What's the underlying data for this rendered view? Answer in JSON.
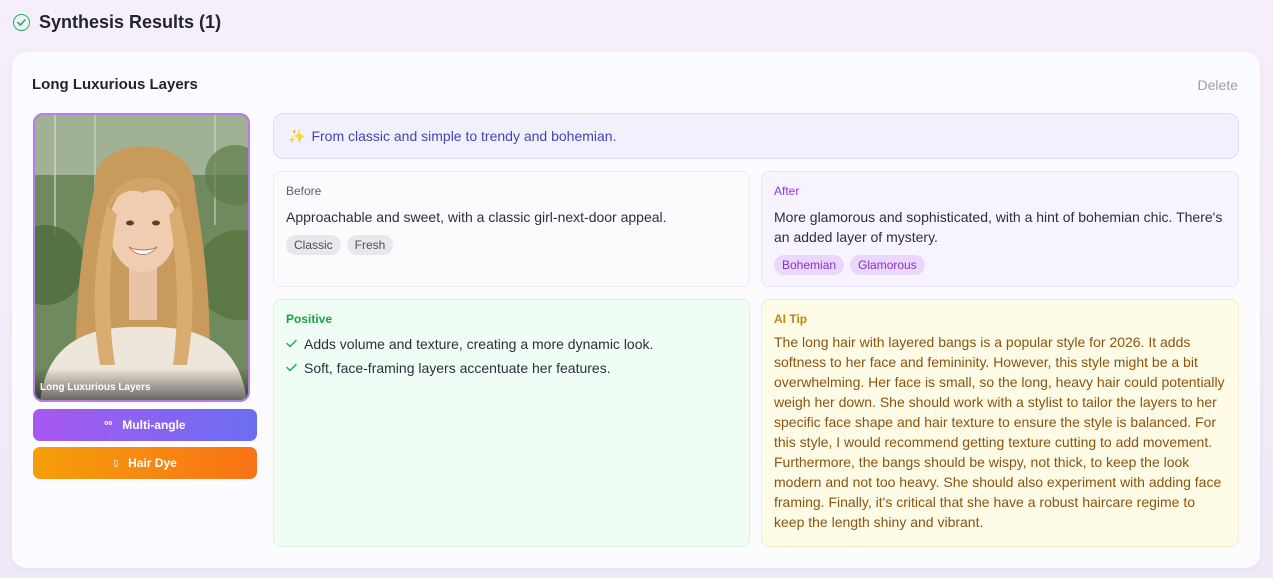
{
  "header": {
    "title": "Synthesis Results (1)"
  },
  "card": {
    "title": "Long Luxurious Layers",
    "delete_label": "Delete",
    "photo_caption": "Long Luxurious Layers",
    "buttons": {
      "multi_angle": {
        "icon": "⁰⁰",
        "label": "Multi-angle"
      },
      "hair_dye": {
        "icon": "▯",
        "label": "Hair Dye"
      }
    },
    "tagline": {
      "icon": "✨",
      "text": "From classic and simple to trendy and bohemian."
    },
    "before": {
      "label": "Before",
      "text": "Approachable and sweet, with a classic girl-next-door appeal.",
      "tags": [
        "Classic",
        "Fresh"
      ]
    },
    "after": {
      "label": "After",
      "text": "More glamorous and sophisticated, with a hint of bohemian chic. There's an added layer of mystery.",
      "tags": [
        "Bohemian",
        "Glamorous"
      ]
    },
    "positive": {
      "label": "Positive",
      "items": [
        "Adds volume and texture, creating a more dynamic look.",
        "Soft, face-framing layers accentuate her features."
      ]
    },
    "ai_tip": {
      "label": "AI Tip",
      "text": "The long hair with layered bangs is a popular style for 2026. It adds softness to her face and femininity. However, this style might be a bit overwhelming. Her face is small, so the long, heavy hair could potentially weigh her down. She should work with a stylist to tailor the layers to her specific face shape and hair texture to ensure the style is balanced. For this style, I would recommend getting texture cutting to add movement. Furthermore, the bangs should be wispy, not thick, to keep the look modern and not too heavy. She should also experiment with adding face framing. Finally, it's critical that she have a robust haircare regime to keep the length shiny and vibrant."
    }
  },
  "colors": {
    "accent_purple": "#a858f0",
    "accent_orange": "#f97316",
    "success_green": "#22b35b",
    "tip_amber": "#c1860e"
  }
}
